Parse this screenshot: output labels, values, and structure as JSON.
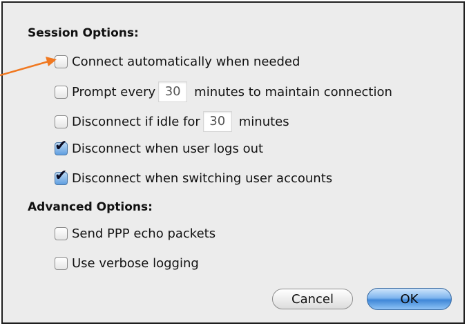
{
  "session_options": {
    "heading": "Session Options:",
    "connect_auto": {
      "label": "Connect automatically when needed",
      "checked": false
    },
    "prompt_every": {
      "label_before": "Prompt every",
      "value": "30",
      "label_after": "minutes to maintain connection",
      "checked": false
    },
    "disconnect_idle": {
      "label_before": "Disconnect if idle for",
      "value": "30",
      "label_after": "minutes",
      "checked": false
    },
    "disconnect_logout": {
      "label": "Disconnect when user logs out",
      "checked": true
    },
    "disconnect_switch": {
      "label": "Disconnect when switching user accounts",
      "checked": true
    }
  },
  "advanced_options": {
    "heading": "Advanced Options:",
    "send_echo": {
      "label": "Send PPP echo packets",
      "checked": false
    },
    "verbose_logging": {
      "label": "Use verbose logging",
      "checked": false
    }
  },
  "buttons": {
    "cancel": "Cancel",
    "ok": "OK"
  },
  "annotation": {
    "arrow_color": "#f07820"
  },
  "colors": {
    "panel_bg": "#ececec",
    "border": "#1e1e1e",
    "checkbox_checked": "#5f9ee0"
  }
}
